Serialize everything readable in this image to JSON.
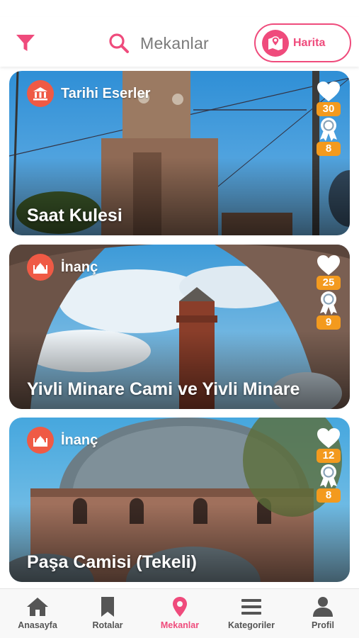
{
  "header": {
    "search_label": "Mekanlar",
    "map_button_label": "Harita",
    "accent_color": "#ef4b7c"
  },
  "places": [
    {
      "category": "Tarihi Eserler",
      "category_icon": "museum-icon",
      "title": "Saat Kulesi",
      "likes": "30",
      "badges": "8"
    },
    {
      "category": "İnanç",
      "category_icon": "mosque-icon",
      "title": "Yivli Minare Cami ve Yivli Minare",
      "likes": "25",
      "badges": "9"
    },
    {
      "category": "İnanç",
      "category_icon": "mosque-icon",
      "title": "Paşa Camisi (Tekeli)",
      "likes": "12",
      "badges": "8"
    }
  ],
  "tabbar": {
    "items": [
      {
        "label": "Anasayfa",
        "icon": "home-icon"
      },
      {
        "label": "Rotalar",
        "icon": "bookmark-icon"
      },
      {
        "label": "Mekanlar",
        "icon": "location-pin-icon",
        "active": true
      },
      {
        "label": "Kategoriler",
        "icon": "list-icon"
      },
      {
        "label": "Profil",
        "icon": "user-icon"
      }
    ]
  }
}
